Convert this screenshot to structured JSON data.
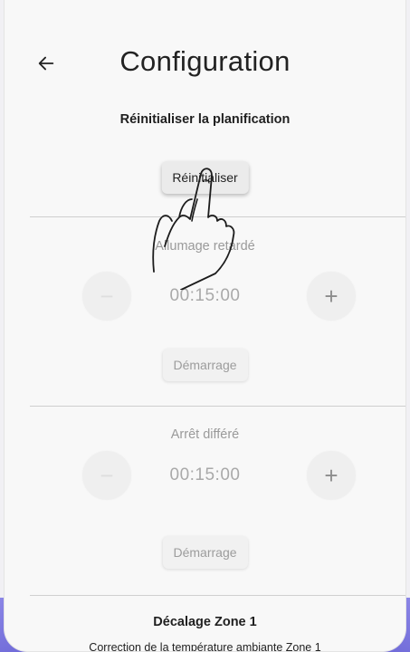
{
  "header": {
    "title": "Configuration",
    "back_icon": "arrow-left-icon"
  },
  "reset_section": {
    "title": "Réinitialiser la planification",
    "button_label": "Réinitialiser"
  },
  "delayed_start": {
    "title": "Allumage retardé",
    "value": "00:15:00",
    "minus_label": "−",
    "plus_label": "+",
    "start_label": "Démarrage"
  },
  "delayed_stop": {
    "title": "Arrêt différé",
    "value": "00:15:00",
    "minus_label": "−",
    "plus_label": "+",
    "start_label": "Démarrage"
  },
  "zone_offset": {
    "title": "Décalage Zone 1",
    "subtitle": "Correction de la température ambiante Zone 1"
  },
  "overlay": {
    "pointer_icon": "pointing-hand-icon"
  }
}
